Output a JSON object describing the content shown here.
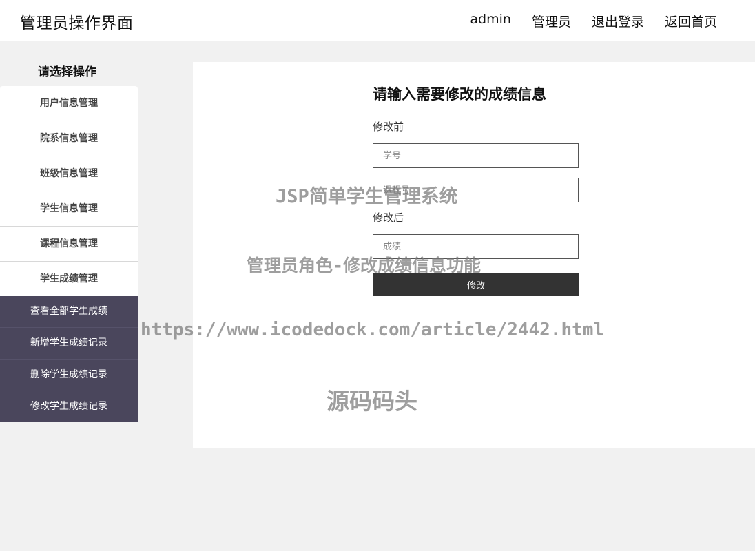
{
  "header": {
    "title": "管理员操作界面",
    "nav": [
      "admin",
      "管理员",
      "退出登录",
      "返回首页"
    ]
  },
  "sidebar": {
    "title": "请选择操作",
    "items": [
      "用户信息管理",
      "院系信息管理",
      "班级信息管理",
      "学生信息管理",
      "课程信息管理",
      "学生成绩管理"
    ],
    "submenu": [
      "查看全部学生成绩",
      "新增学生成绩记录",
      "删除学生成绩记录",
      "修改学生成绩记录"
    ]
  },
  "form": {
    "title": "请输入需要修改的成绩信息",
    "before_label": "修改前",
    "student_id_placeholder": "学号",
    "course_id_placeholder": "课程号",
    "after_label": "修改后",
    "score_placeholder": "成绩",
    "submit_label": "修改"
  },
  "watermark": {
    "line1": "JSP简单学生管理系统",
    "line2": "管理员角色-修改成绩信息功能",
    "line3": "https://www.icodedock.com/article/2442.html",
    "line4": "源码码头"
  },
  "colors": {
    "submenu_bg": "#4a465c",
    "button_bg": "#333333",
    "page_bg": "#f1f1f1"
  }
}
